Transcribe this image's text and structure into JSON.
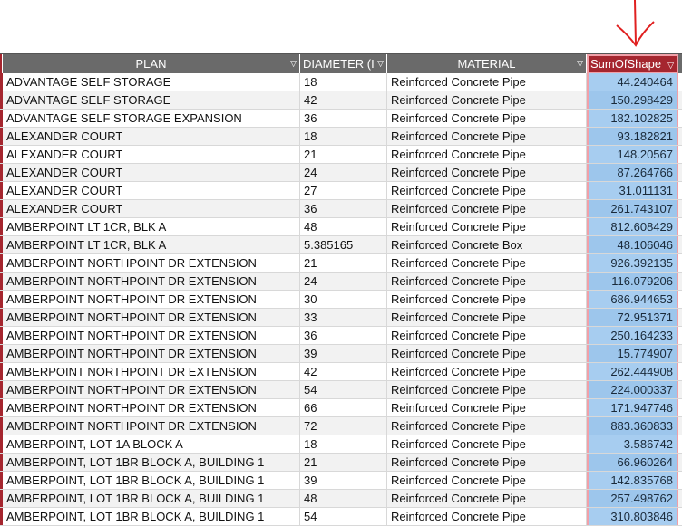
{
  "columns": [
    "PLAN",
    "DIAMETER (I",
    "MATERIAL",
    "SumOfShape"
  ],
  "accent": "#a5262f",
  "rows": [
    [
      "ADVANTAGE SELF STORAGE",
      "18",
      "Reinforced Concrete Pipe",
      "44.240464"
    ],
    [
      "ADVANTAGE SELF STORAGE",
      "42",
      "Reinforced Concrete Pipe",
      "150.298429"
    ],
    [
      "ADVANTAGE SELF STORAGE EXPANSION",
      "36",
      "Reinforced Concrete Pipe",
      "182.102825"
    ],
    [
      "ALEXANDER COURT",
      "18",
      "Reinforced Concrete Pipe",
      "93.182821"
    ],
    [
      "ALEXANDER COURT",
      "21",
      "Reinforced Concrete Pipe",
      "148.20567"
    ],
    [
      "ALEXANDER COURT",
      "24",
      "Reinforced Concrete Pipe",
      "87.264766"
    ],
    [
      "ALEXANDER COURT",
      "27",
      "Reinforced Concrete Pipe",
      "31.011131"
    ],
    [
      "ALEXANDER COURT",
      "36",
      "Reinforced Concrete Pipe",
      "261.743107"
    ],
    [
      "AMBERPOINT LT 1CR, BLK A",
      "48",
      "Reinforced Concrete Pipe",
      "812.608429"
    ],
    [
      "AMBERPOINT LT 1CR, BLK A",
      "5.385165",
      "Reinforced Concrete Box",
      "48.106046"
    ],
    [
      "AMBERPOINT NORTHPOINT DR EXTENSION",
      "21",
      "Reinforced Concrete Pipe",
      "926.392135"
    ],
    [
      "AMBERPOINT NORTHPOINT DR EXTENSION",
      "24",
      "Reinforced Concrete Pipe",
      "116.079206"
    ],
    [
      "AMBERPOINT NORTHPOINT DR EXTENSION",
      "30",
      "Reinforced Concrete Pipe",
      "686.944653"
    ],
    [
      "AMBERPOINT NORTHPOINT DR EXTENSION",
      "33",
      "Reinforced Concrete Pipe",
      "72.951371"
    ],
    [
      "AMBERPOINT NORTHPOINT DR EXTENSION",
      "36",
      "Reinforced Concrete Pipe",
      "250.164233"
    ],
    [
      "AMBERPOINT NORTHPOINT DR EXTENSION",
      "39",
      "Reinforced Concrete Pipe",
      "15.774907"
    ],
    [
      "AMBERPOINT NORTHPOINT DR EXTENSION",
      "42",
      "Reinforced Concrete Pipe",
      "262.444908"
    ],
    [
      "AMBERPOINT NORTHPOINT DR EXTENSION",
      "54",
      "Reinforced Concrete Pipe",
      "224.000337"
    ],
    [
      "AMBERPOINT NORTHPOINT DR EXTENSION",
      "66",
      "Reinforced Concrete Pipe",
      "171.947746"
    ],
    [
      "AMBERPOINT NORTHPOINT DR EXTENSION",
      "72",
      "Reinforced Concrete Pipe",
      "883.360833"
    ],
    [
      "AMBERPOINT, LOT 1A BLOCK A",
      "18",
      "Reinforced Concrete Pipe",
      "3.586742"
    ],
    [
      "AMBERPOINT, LOT 1BR BLOCK A, BUILDING 1",
      "21",
      "Reinforced Concrete Pipe",
      "66.960264"
    ],
    [
      "AMBERPOINT, LOT 1BR BLOCK A, BUILDING 1",
      "39",
      "Reinforced Concrete Pipe",
      "142.835768"
    ],
    [
      "AMBERPOINT, LOT 1BR BLOCK A, BUILDING 1",
      "48",
      "Reinforced Concrete Pipe",
      "257.498762"
    ],
    [
      "AMBERPOINT, LOT 1BR BLOCK A, BUILDING 1",
      "54",
      "Reinforced Concrete Pipe",
      "310.803846"
    ]
  ]
}
